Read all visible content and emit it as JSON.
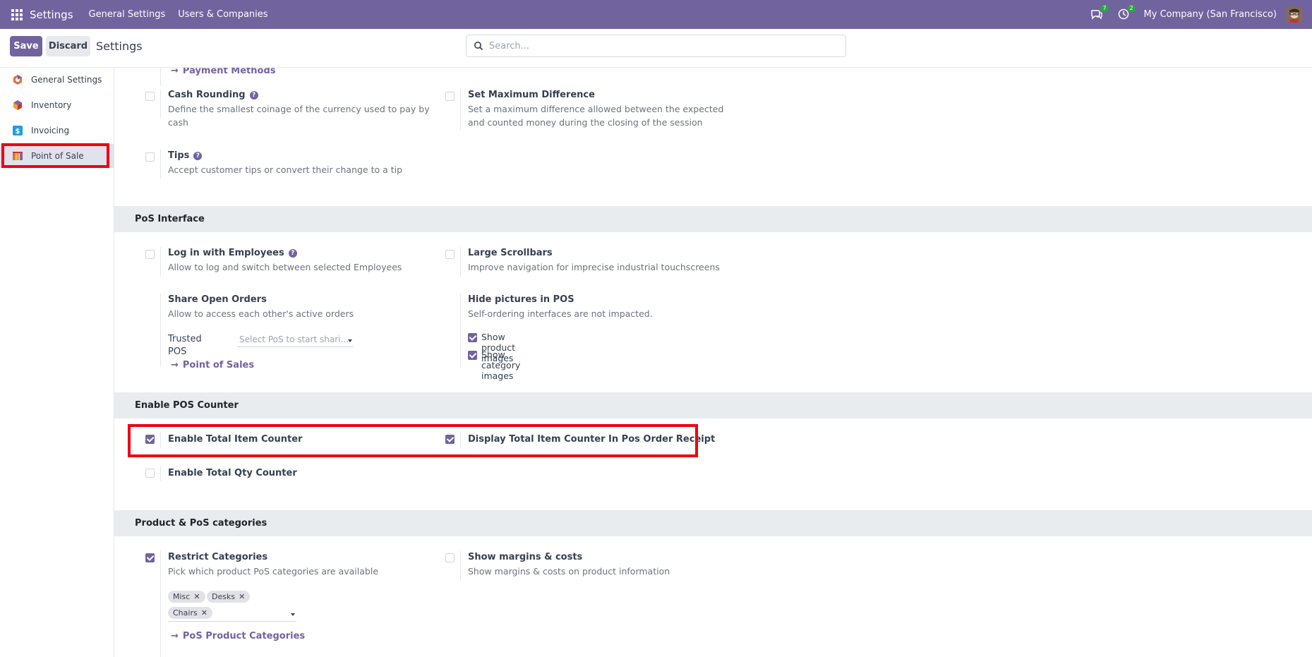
{
  "navbar": {
    "brand": "Settings",
    "menus": [
      "General Settings",
      "Users & Companies"
    ],
    "messages_badge": "7",
    "activities_badge": "2",
    "company": "My Company (San Francisco)",
    "bg_color": "#71639e"
  },
  "control": {
    "save_label": "Save",
    "discard_label": "Discard",
    "title": "Settings",
    "search_placeholder": "Search..."
  },
  "sidebar": {
    "items": [
      {
        "label": "General Settings",
        "icon": "general-settings-icon"
      },
      {
        "label": "Inventory",
        "icon": "inventory-icon"
      },
      {
        "label": "Invoicing",
        "icon": "invoicing-icon"
      },
      {
        "label": "Point of Sale",
        "icon": "point-of-sale-icon",
        "active": true
      }
    ]
  },
  "payments": {
    "payment_methods_link": "Payment Methods",
    "cash_rounding": {
      "title": "Cash Rounding",
      "desc": "Define the smallest coinage of the currency used to pay by cash",
      "checked": false
    },
    "max_difference": {
      "title": "Set Maximum Difference",
      "desc": "Set a maximum difference allowed between the expected and counted money during the closing of the session",
      "checked": false
    },
    "tips": {
      "title": "Tips",
      "desc": "Accept customer tips or convert their change to a tip",
      "checked": false
    }
  },
  "pos_interface": {
    "header": "PoS Interface",
    "login_employees": {
      "title": "Log in with Employees",
      "desc": "Allow to log and switch between selected Employees",
      "checked": false
    },
    "large_scrollbars": {
      "title": "Large Scrollbars",
      "desc": "Improve navigation for imprecise industrial touchscreens",
      "checked": false
    },
    "share_orders": {
      "title": "Share Open Orders",
      "desc": "Allow to access each other's active orders",
      "trusted_label": "Trusted POS",
      "trusted_placeholder": "Select PoS to start shari...",
      "link": "Point of Sales"
    },
    "hide_pictures": {
      "title": "Hide pictures in POS",
      "desc": "Self-ordering interfaces are not impacted.",
      "show_product_images": "Show product images",
      "show_category_images": "Show category images"
    }
  },
  "pos_counter": {
    "header": "Enable POS Counter",
    "total_item": {
      "title": "Enable Total Item Counter",
      "checked": true
    },
    "display_receipt": {
      "title": "Display Total Item Counter In Pos Order Receipt",
      "checked": true
    },
    "total_qty": {
      "title": "Enable Total Qty Counter",
      "checked": false
    }
  },
  "categories": {
    "header": "Product & PoS categories",
    "restrict": {
      "title": "Restrict Categories",
      "desc": "Pick which product PoS categories are available",
      "checked": true,
      "tags": [
        "Misc",
        "Desks",
        "Chairs"
      ],
      "link": "PoS Product Categories"
    },
    "margins": {
      "title": "Show margins & costs",
      "desc": "Show margins & costs on product information",
      "checked": false
    }
  }
}
